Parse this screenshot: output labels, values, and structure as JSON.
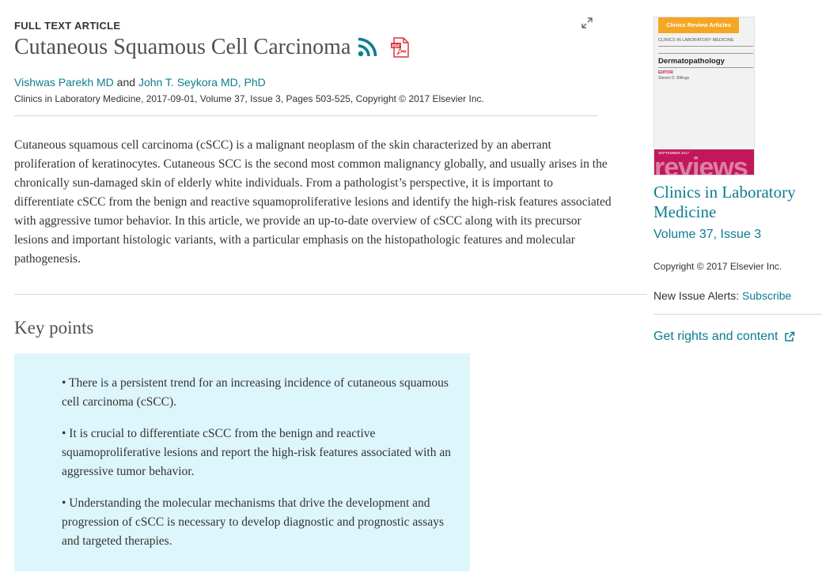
{
  "article": {
    "type_label": "FULL TEXT ARTICLE",
    "title": "Cutaneous Squamous Cell Carcinoma",
    "authors": [
      {
        "name": "Vishwas Parekh MD"
      },
      {
        "name": "John T. Seykora MD, PhD"
      }
    ],
    "author_separator": " and ",
    "citation": "Clinics in Laboratory Medicine, 2017-09-01, Volume 37, Issue 3, Pages 503-525, Copyright © 2017 Elsevier Inc.",
    "abstract": "Cutaneous squamous cell carcinoma (cSCC) is a malignant neoplasm of the skin characterized by an aberrant proliferation of keratinocytes. Cutaneous SCC is the second most common malignancy globally, and usually arises in the chronically sun-damaged skin of elderly white individuals. From a pathologist’s perspective, it is important to differentiate cSCC from the benign and reactive squamoproliferative lesions and identify the high-risk features associated with aggressive tumor behavior. In this article, we provide an up-to-date overview of cSCC along with its precursor lesions and important histologic variants, with a particular emphasis on the histopathologic features and molecular pathogenesis."
  },
  "key_points": {
    "heading": "Key points",
    "items": [
      "• There is a persistent trend for an increasing incidence of cutaneous squamous cell carcinoma (cSCC).",
      "• It is crucial to differentiate cSCC from the benign and reactive squamoproliferative lesions and report the high-risk features associated with an aggressive tumor behavior.",
      "• Understanding the molecular mechanisms that drive the development and progression of cSCC is necessary to develop diagnostic and prognostic assays and targeted therapies."
    ]
  },
  "sidebar": {
    "cover": {
      "badge": "Clinics Review Articles",
      "series": "CLINICS IN LABORATORY MEDICINE",
      "topic": "Dermatopathology",
      "editor_label": "EDITOR",
      "editor_name": "Steven D. Billings",
      "date": "SEPTEMBER 2017",
      "band_word": "reviews",
      "band_color": "#c2185b",
      "badge_color": "#f5a623"
    },
    "journal_title": "Clinics in Laboratory Medicine",
    "volume": "Volume 37, Issue 3",
    "copyright": "Copyright © 2017 Elsevier Inc.",
    "alerts_label": "New Issue Alerts:",
    "subscribe_label": "Subscribe",
    "rights_label": "Get rights and content"
  },
  "icons": {
    "expand": "expand-icon",
    "rss": "rss-icon",
    "pdf": "pdf-icon",
    "external": "external-link-icon"
  },
  "colors": {
    "link": "#0c7d91",
    "key_points_bg": "#ddf6fc",
    "pdf_red": "#d9363e"
  }
}
